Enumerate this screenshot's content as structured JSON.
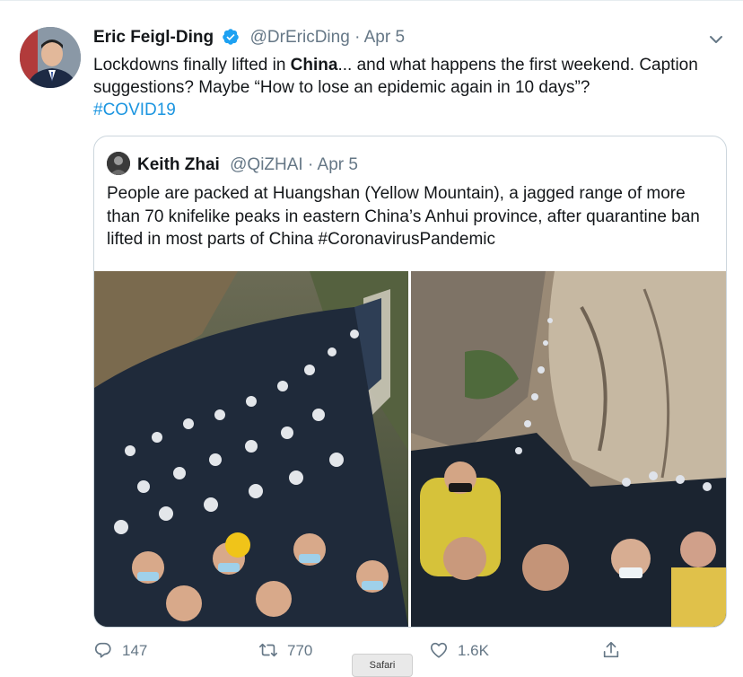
{
  "tweet": {
    "author_name": "Eric Feigl-Ding",
    "handle": "@DrEricDing",
    "separator": "·",
    "date": "Apr 5",
    "text_before_bold": "Lockdowns finally lifted in ",
    "text_bold": "China",
    "text_after_bold": "... and what happens the first weekend. Caption suggestions? Maybe “How to lose an epidemic again in 10 days”?",
    "hashtag": "#COVID19"
  },
  "quoted_tweet": {
    "author_name": "Keith Zhai",
    "handle": "@QiZHAI",
    "separator": "·",
    "date": "Apr 5",
    "text": "People are packed at Huangshan (Yellow Mountain), a jagged range of more than 70 knifelike peaks in eastern China’s Anhui province, after quarantine ban lifted in most parts of China",
    "hashtag": "#CoronavirusPandemic"
  },
  "actions": {
    "reply_count": "147",
    "retweet_count": "770",
    "like_count": "1.6K"
  },
  "tooltip": {
    "label": "Safari"
  },
  "colors": {
    "link": "#1b95e0",
    "muted": "#657786",
    "verified": "#1da1f2",
    "border": "#ccd6dd"
  },
  "icons": [
    "verified-badge-icon",
    "chevron-down-icon",
    "reply-icon",
    "retweet-icon",
    "like-icon",
    "share-icon"
  ]
}
